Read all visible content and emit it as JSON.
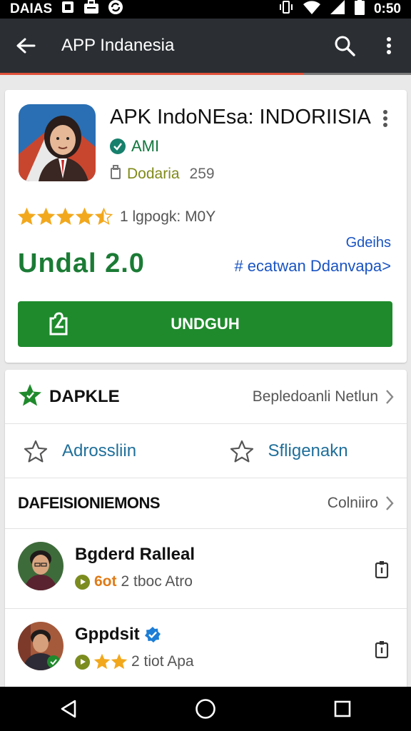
{
  "status_bar": {
    "carrier": "DAIAS",
    "time": "0:50"
  },
  "app_bar": {
    "title": "APP Indanesia",
    "progress_fraction": 0.74
  },
  "app": {
    "title": "APK IndoNEsa: INDORIISIA",
    "developer": "AMI",
    "category": "Dodaria",
    "category_count": "259",
    "rating_stars": 4.5,
    "rating_text": "1 lgpogk: M0Y",
    "price": "Undal 2.0",
    "side_link_top": "Gdeihs",
    "side_link": "# ecatwan Ddanvapa>",
    "install_label": "UNDGUH"
  },
  "section": {
    "title": "DAPKLE",
    "more_label": "Bepledoanli Netlun"
  },
  "tabs": [
    {
      "label": "Adrossliin"
    },
    {
      "label": "Sfligenakn"
    }
  ],
  "section2": {
    "title": "DAFEISIONIEMONS",
    "more_label": "Colniiro"
  },
  "list": [
    {
      "name": "Bgderd Ralleal",
      "meta_accent": "6ot",
      "meta_text": "2 tboc Atro",
      "verified": false
    },
    {
      "name": "Gppdsit",
      "meta_accent": "",
      "meta_text": "2 tiot Apa",
      "verified": true,
      "stars": 2
    }
  ],
  "colors": {
    "accent_green": "#1f8a2c",
    "price_green": "#1b7b35",
    "link_blue": "#1a54c2",
    "star_orange": "#f2a81d",
    "progress_red": "#e0513a"
  }
}
